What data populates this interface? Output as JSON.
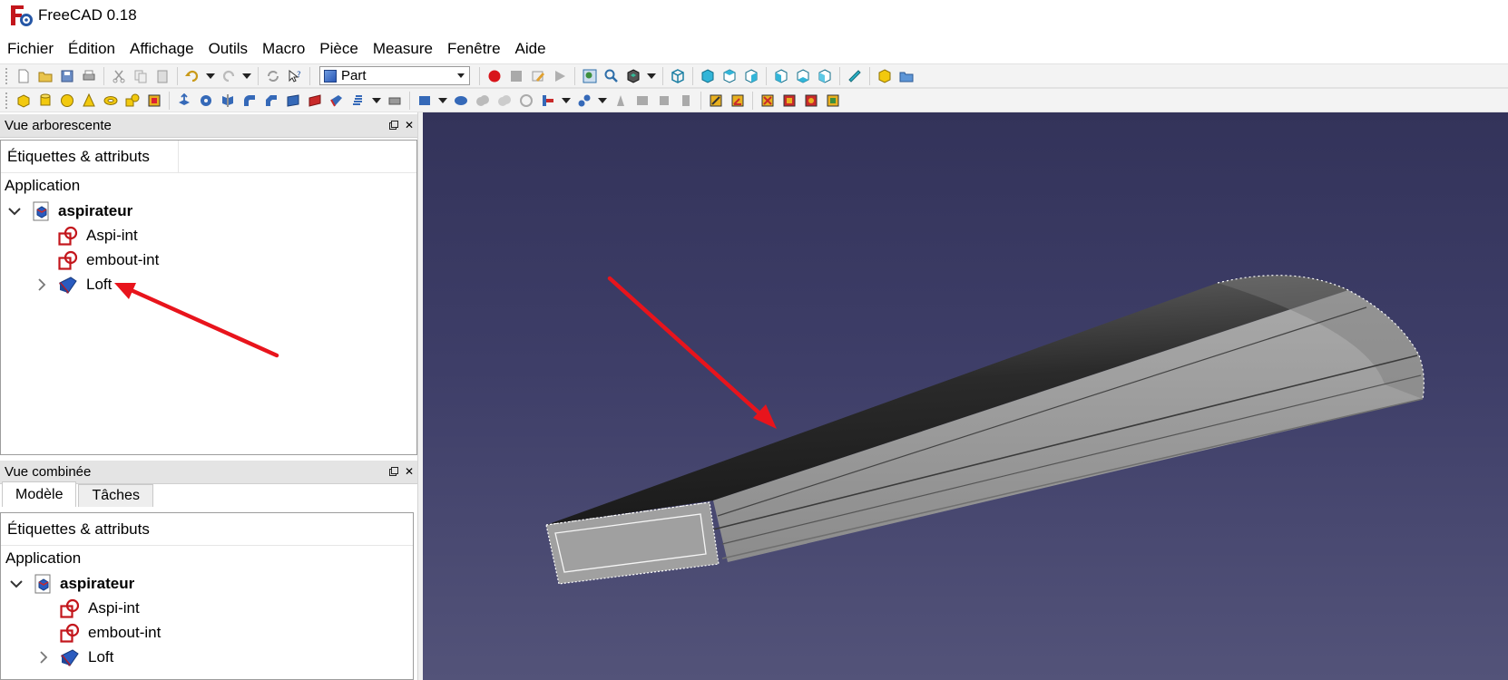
{
  "window": {
    "title": "FreeCAD 0.18"
  },
  "menu": [
    "Fichier",
    "Édition",
    "Affichage",
    "Outils",
    "Macro",
    "Pièce",
    "Measure",
    "Fenêtre",
    "Aide"
  ],
  "toolbar": {
    "workbench": "Part"
  },
  "tree_panel": {
    "title": "Vue arborescente",
    "float_icon": "▫",
    "close_icon": "✕",
    "column_header": "Étiquettes & attributs",
    "root": "Application",
    "document": "aspirateur",
    "items": [
      "Aspi-int",
      "embout-int",
      "Loft"
    ]
  },
  "combo_panel": {
    "title": "Vue combinée",
    "tabs": [
      "Modèle",
      "Tâches"
    ],
    "column_header": "Étiquettes & attributs",
    "root": "Application",
    "document": "aspirateur",
    "items": [
      "Aspi-int",
      "embout-int",
      "Loft"
    ]
  },
  "colors": {
    "viewport_top": "#33335a",
    "viewport_bottom": "#535379",
    "annotation_arrow": "#e8141c",
    "sketch_icon": "#c3161c",
    "loft_icon": "#2a5bbf"
  }
}
